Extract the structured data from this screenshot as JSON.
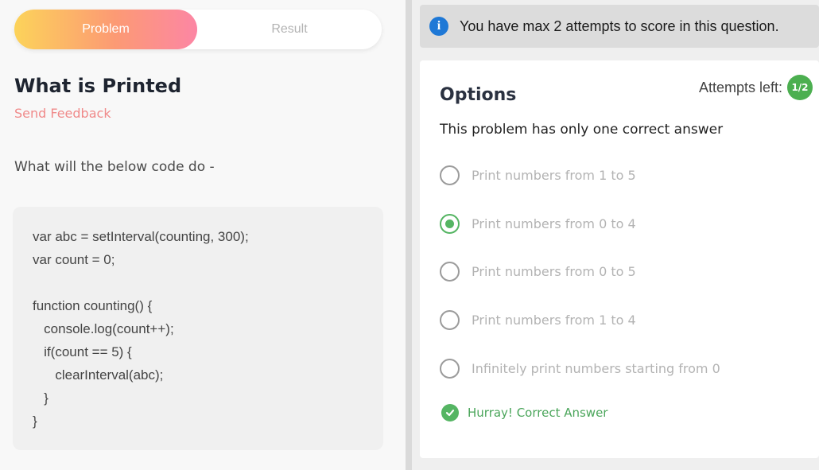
{
  "tabs": {
    "problem": "Problem",
    "result": "Result"
  },
  "problem": {
    "title": "What is Printed",
    "feedback": "Send Feedback",
    "question": "What will the below code do -",
    "code_lines": [
      "var abc = setInterval(counting, 300);",
      "var count = 0;",
      "",
      "function counting() {",
      "   console.log(count++);",
      "   if(count == 5) {",
      "      clearInterval(abc);",
      "   }",
      "}"
    ]
  },
  "banner": {
    "icon": "info-icon",
    "text": "You have max 2 attempts to score in this question."
  },
  "options_panel": {
    "title": "Options",
    "attempts_label": "Attempts left:",
    "attempts_value": "1/2",
    "subtitle": "This problem has only one correct answer",
    "options": [
      {
        "label": "Print numbers from 1 to 5",
        "selected": false
      },
      {
        "label": "Print numbers from 0 to 4",
        "selected": true
      },
      {
        "label": "Print numbers from 0 to 5",
        "selected": false
      },
      {
        "label": "Print numbers from 1 to 4",
        "selected": false
      },
      {
        "label": "Infinitely print numbers starting from 0",
        "selected": false
      }
    ],
    "result_text": "Hurray! Correct Answer"
  },
  "colors": {
    "accent_green": "#55b563",
    "info_blue": "#1e78d6",
    "feedback_pink": "#f08a8a"
  }
}
